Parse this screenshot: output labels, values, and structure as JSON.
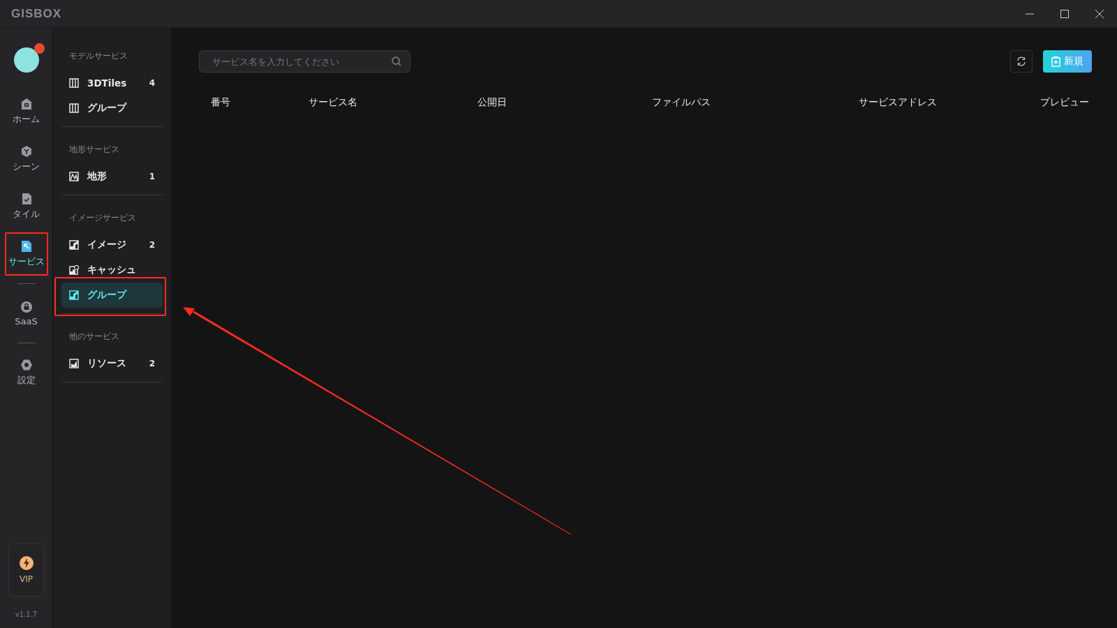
{
  "window": {
    "logo": "GISBOX"
  },
  "nav": {
    "items": [
      {
        "kind": "home",
        "label": "ホーム",
        "selected": false,
        "highlighted": false
      },
      {
        "kind": "scene",
        "label": "シーン",
        "selected": false,
        "highlighted": false
      },
      {
        "kind": "tile",
        "label": "タイル",
        "selected": false,
        "highlighted": false
      },
      {
        "kind": "service",
        "label": "サービス",
        "selected": true,
        "highlighted": true
      },
      {
        "kind": "saas",
        "label": "SaaS",
        "selected": false,
        "highlighted": false
      },
      {
        "kind": "settings",
        "label": "設定",
        "selected": false,
        "highlighted": false
      }
    ],
    "vip": "VIP",
    "version": "v1.1.7"
  },
  "sidebar": {
    "sections": [
      {
        "title": "モデルサービス",
        "items": [
          {
            "kind": "model",
            "label": "3DTiles",
            "count": "4",
            "selected": false,
            "highlighted": false
          },
          {
            "kind": "model",
            "label": "グループ",
            "selected": false,
            "highlighted": false
          }
        ]
      },
      {
        "title": "地形サービス",
        "items": [
          {
            "kind": "terrain",
            "label": "地形",
            "count": "1",
            "selected": false,
            "highlighted": false
          }
        ]
      },
      {
        "title": "イメージサービス",
        "items": [
          {
            "kind": "image",
            "label": "イメージ",
            "count": "2",
            "selected": false,
            "highlighted": false
          },
          {
            "kind": "cache",
            "label": "キャッシュ",
            "selected": false,
            "highlighted": false
          },
          {
            "kind": "image",
            "label": "グループ",
            "selected": true,
            "highlighted": true
          }
        ]
      },
      {
        "title": "他のサービス",
        "items": [
          {
            "kind": "resource",
            "label": "リソース",
            "count": "2",
            "selected": false,
            "highlighted": false
          }
        ]
      }
    ]
  },
  "search": {
    "placeholder": "サービス名を入力してください"
  },
  "new_button": "新規",
  "table": {
    "columns": [
      "番号",
      "サービス名",
      "公開日",
      "ファイルパス",
      "サービスアドレス",
      "プレビュー"
    ]
  },
  "annotation_arrow": true
}
